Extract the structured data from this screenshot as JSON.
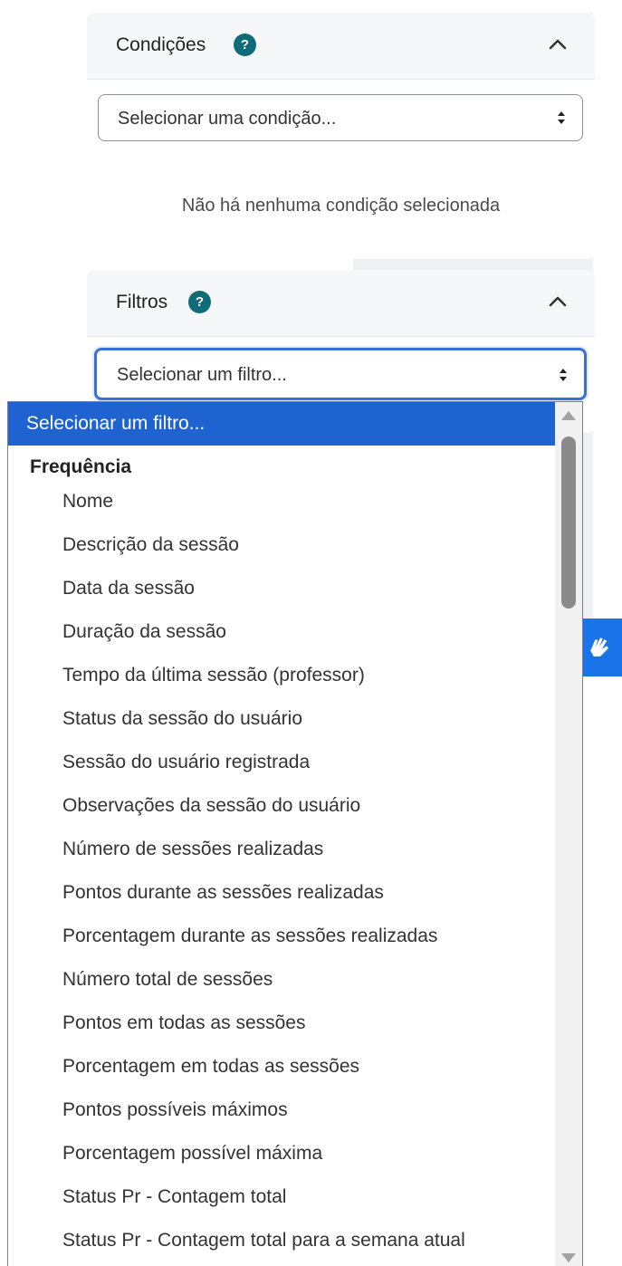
{
  "conditions": {
    "title": "Condições",
    "help": "?",
    "select_value": "Selecionar uma condição...",
    "empty_message": "Não há nenhuma condição selecionada"
  },
  "filters": {
    "title": "Filtros",
    "help": "?",
    "select_value": "Selecionar um filtro..."
  },
  "dropdown": {
    "selected_option": "Selecionar um filtro...",
    "group_label": "Frequência",
    "options": [
      "Nome",
      "Descrição da sessão",
      "Data da sessão",
      "Duração da sessão",
      "Tempo da última sessão (professor)",
      "Status da sessão do usuário",
      "Sessão do usuário registrada",
      "Observações da sessão do usuário",
      "Número de sessões realizadas",
      "Pontos durante as sessões realizadas",
      "Porcentagem durante as sessões realizadas",
      "Número total de sessões",
      "Pontos em todas as sessões",
      "Porcentagem em todas as sessões",
      "Pontos possíveis máximos",
      "Porcentagem possível máxima",
      "Status Pr - Contagem total",
      "Status Pr - Contagem total para a semana atual"
    ]
  },
  "colors": {
    "help_icon": "#0f6b78",
    "selected_option": "#1e63cf",
    "focus_border": "#3a6fd8",
    "accessibility_button": "#1a73e8"
  },
  "icons": {
    "help": "help-icon",
    "collapse": "chevron-up-icon",
    "select_arrows": "select-arrows-icon",
    "accessibility": "sign-language-icon"
  }
}
